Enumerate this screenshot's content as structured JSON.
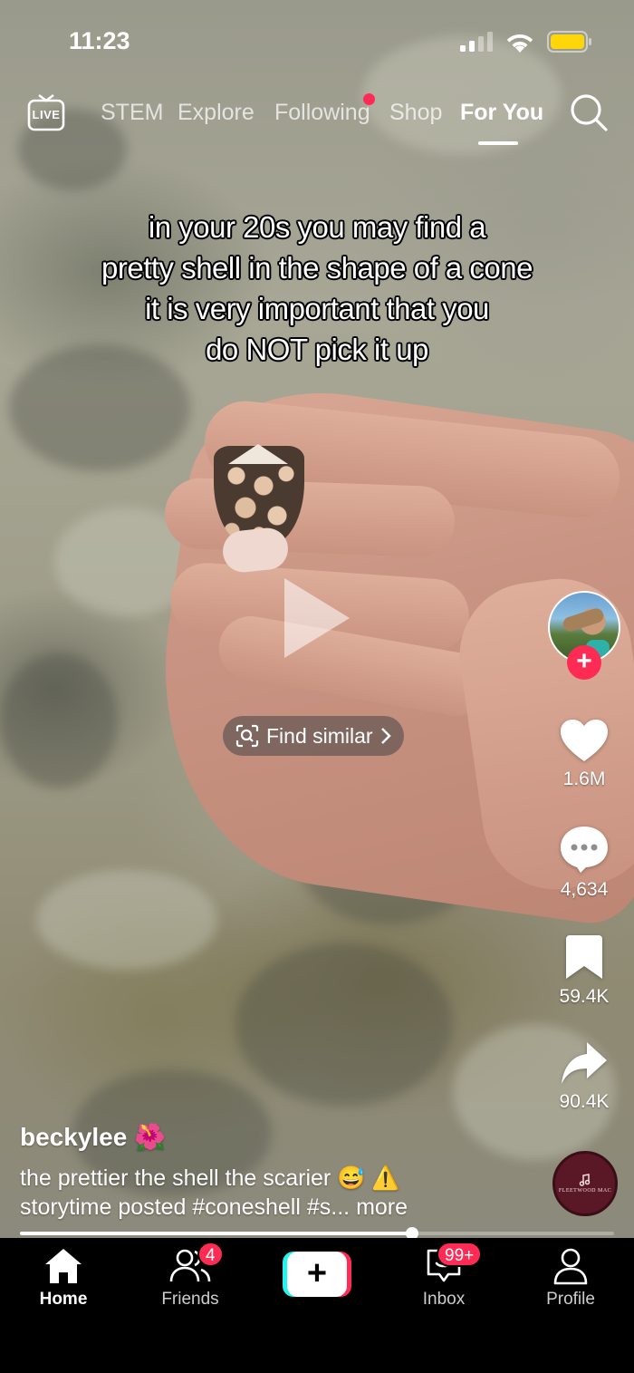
{
  "status_bar": {
    "time": "11:23"
  },
  "top_nav": {
    "live_label": "LIVE",
    "tabs": [
      {
        "label": "STEM"
      },
      {
        "label": "Explore"
      },
      {
        "label": "Following"
      },
      {
        "label": "Shop"
      },
      {
        "label": "For You"
      }
    ],
    "active_tab": "For You"
  },
  "video": {
    "caption_lines": [
      "in your 20s you may find a",
      "pretty shell in the shape of a cone",
      "it is very important that you",
      "do NOT pick it up"
    ],
    "find_similar_label": "Find similar",
    "progress": 0.66
  },
  "actions": {
    "likes": "1.6M",
    "comments": "4,634",
    "saves": "59.4K",
    "shares": "90.4K"
  },
  "post": {
    "username": "beckylee",
    "username_emoji": "🌺",
    "description_text": "the prettier the shell the scarier",
    "description_emojis": "😅 ⚠️",
    "second_line_text": "storytime posted",
    "hashtag": "#coneshell",
    "hashtag_more": "#s...",
    "more_label": "more"
  },
  "music": {
    "brand": "FLEETWOOD MAC"
  },
  "bottom_nav": {
    "home": "Home",
    "friends": "Friends",
    "friends_badge": "4",
    "inbox": "Inbox",
    "inbox_badge": "99+",
    "profile": "Profile"
  },
  "colors": {
    "accent": "#fe2c55",
    "create_cyan": "#25f4ee",
    "background": "#000000"
  }
}
